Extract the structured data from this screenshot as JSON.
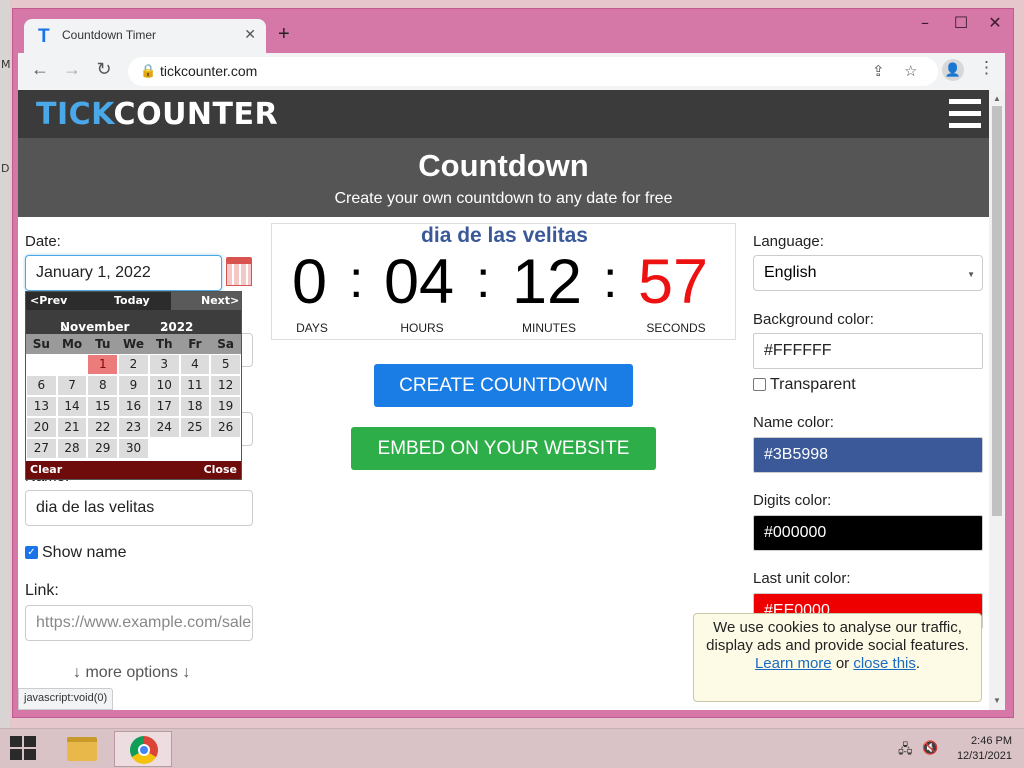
{
  "desktop": {
    "glyph_top": "M",
    "glyph_bottom": "D"
  },
  "window": {
    "minimize": "–",
    "maximize": "☐",
    "close": "✕"
  },
  "tab": {
    "favicon": "T",
    "title": "Countdown Timer",
    "close": "✕",
    "new_tab": "+"
  },
  "toolbar": {
    "back": "←",
    "forward": "→",
    "reload": "↻",
    "lock": "🔒",
    "url": "tickcounter.com",
    "share": "⇪",
    "bookmark": "☆",
    "profile": "👤",
    "menu": "⋮"
  },
  "site": {
    "logo_a": "TICK",
    "logo_b": "COUNTER",
    "title": "Countdown",
    "subtitle": "Create your own countdown to any date for free"
  },
  "form": {
    "date_label": "Date:",
    "date_value": "January 1, 2022",
    "name_label_partial": "Name:",
    "name_value": "dia de las velitas",
    "show_name_label": "Show name",
    "show_name_checked": true,
    "link_label": "Link:",
    "link_placeholder": "https://www.example.com/sale",
    "more_options": "↓ more options ↓"
  },
  "datepicker": {
    "prev": "<Prev",
    "today": "Today",
    "next": "Next>",
    "month": "November",
    "year": "2022",
    "chevron": "⌄",
    "weekdays": [
      "Su",
      "Mo",
      "Tu",
      "We",
      "Th",
      "Fr",
      "Sa"
    ],
    "days": [
      "",
      "",
      "1",
      "2",
      "3",
      "4",
      "5",
      "6",
      "7",
      "8",
      "9",
      "10",
      "11",
      "12",
      "13",
      "14",
      "15",
      "16",
      "17",
      "18",
      "19",
      "20",
      "21",
      "22",
      "23",
      "24",
      "25",
      "26",
      "27",
      "28",
      "29",
      "30",
      "",
      "",
      ""
    ],
    "selected_day": "1",
    "clear": "Clear",
    "close": "Close"
  },
  "timer": {
    "name": "dia de las velitas",
    "days": "0",
    "hours": "04",
    "minutes": "12",
    "seconds": "57",
    "separator": ":",
    "days_label": "DAYS",
    "hours_label": "HOURS",
    "minutes_label": "MINUTES",
    "seconds_label": "SECONDS",
    "name_color": "#3B5998",
    "digits_color": "#000000",
    "last_unit_color": "#EE1111"
  },
  "buttons": {
    "create": "CREATE COUNTDOWN",
    "embed": "EMBED ON YOUR WEBSITE"
  },
  "settings": {
    "language_label": "Language:",
    "language_value": "English",
    "caret": "▼",
    "bg_color_label": "Background color:",
    "bg_color_value": "#FFFFFF",
    "transparent_label": "Transparent",
    "transparent_checked": false,
    "name_color_label": "Name color:",
    "name_color_value": "#3B5998",
    "digits_color_label": "Digits color:",
    "digits_color_value": "#000000",
    "last_unit_label": "Last unit color:",
    "last_unit_value": "#EE0000"
  },
  "cookie": {
    "text": "We use cookies to analyse our traffic, display ads and provide social features.",
    "learn_more": "Learn more",
    "or": "or",
    "close_this": "close this",
    "end": "."
  },
  "status_tip": "javascript:void(0)",
  "taskbar": {
    "tray_network": "🖧",
    "tray_volume": "🔇",
    "time": "2:46 PM",
    "date": "12/31/2021"
  }
}
